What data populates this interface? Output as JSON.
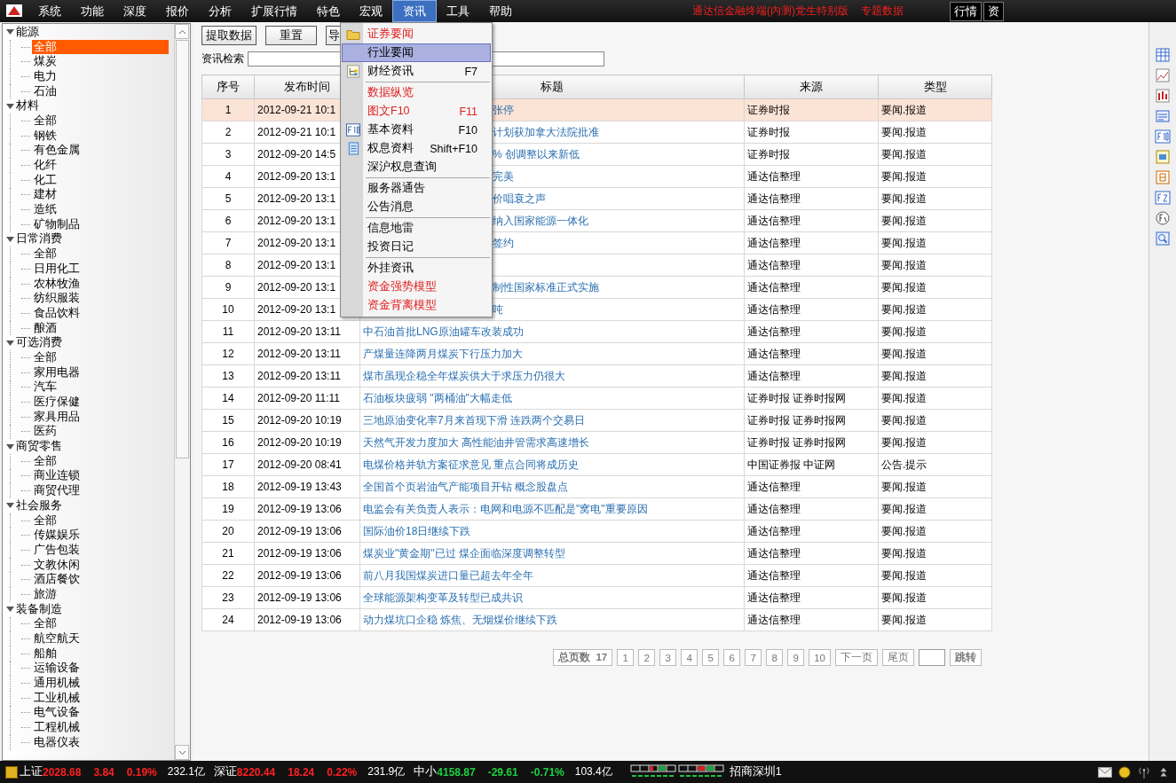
{
  "menu_bar": {
    "items": [
      {
        "label": "系统",
        "selected": false
      },
      {
        "label": "功能",
        "selected": false
      },
      {
        "label": "深度",
        "selected": false
      },
      {
        "label": "报价",
        "selected": false
      },
      {
        "label": "分析",
        "selected": false
      },
      {
        "label": "扩展行情",
        "selected": false
      },
      {
        "label": "特色",
        "selected": false
      },
      {
        "label": "宏观",
        "selected": false
      },
      {
        "label": "资讯",
        "selected": true
      },
      {
        "label": "工具",
        "selected": false
      },
      {
        "label": "帮助",
        "selected": false
      }
    ],
    "title": "通达信金融终端(内测)党生特别版",
    "subtitle": "专题数据",
    "tabs": [
      {
        "label": "行情",
        "selected": false
      },
      {
        "label": "资",
        "selected": false
      }
    ]
  },
  "sidebar": {
    "tree": [
      {
        "label": "能源",
        "expanded": true,
        "children": [
          {
            "label": "全部",
            "selected": true
          },
          {
            "label": "煤炭",
            "selected": false
          },
          {
            "label": "电力",
            "selected": false
          },
          {
            "label": "石油",
            "selected": false
          }
        ]
      },
      {
        "label": "材料",
        "expanded": true,
        "children": [
          {
            "label": "全部",
            "selected": false
          },
          {
            "label": "钢铁",
            "selected": false
          },
          {
            "label": "有色金属",
            "selected": false
          },
          {
            "label": "化纤",
            "selected": false
          },
          {
            "label": "化工",
            "selected": false
          },
          {
            "label": "建材",
            "selected": false
          },
          {
            "label": "造纸",
            "selected": false
          },
          {
            "label": "矿物制品",
            "selected": false
          }
        ]
      },
      {
        "label": "日常消费",
        "expanded": true,
        "children": [
          {
            "label": "全部",
            "selected": false
          },
          {
            "label": "日用化工",
            "selected": false
          },
          {
            "label": "农林牧渔",
            "selected": false
          },
          {
            "label": "纺织服装",
            "selected": false
          },
          {
            "label": "食品饮料",
            "selected": false
          },
          {
            "label": "酿酒",
            "selected": false
          }
        ]
      },
      {
        "label": "可选消费",
        "expanded": true,
        "children": [
          {
            "label": "全部",
            "selected": false
          },
          {
            "label": "家用电器",
            "selected": false
          },
          {
            "label": "汽车",
            "selected": false
          },
          {
            "label": "医疗保健",
            "selected": false
          },
          {
            "label": "家具用品",
            "selected": false
          },
          {
            "label": "医药",
            "selected": false
          }
        ]
      },
      {
        "label": "商贸零售",
        "expanded": true,
        "children": [
          {
            "label": "全部",
            "selected": false
          },
          {
            "label": "商业连锁",
            "selected": false
          },
          {
            "label": "商贸代理",
            "selected": false
          }
        ]
      },
      {
        "label": "社会服务",
        "expanded": true,
        "children": [
          {
            "label": "全部",
            "selected": false
          },
          {
            "label": "传媒娱乐",
            "selected": false
          },
          {
            "label": "广告包装",
            "selected": false
          },
          {
            "label": "文教休闲",
            "selected": false
          },
          {
            "label": "酒店餐饮",
            "selected": false
          },
          {
            "label": "旅游",
            "selected": false
          }
        ]
      },
      {
        "label": "装备制造",
        "expanded": true,
        "children": [
          {
            "label": "全部",
            "selected": false
          },
          {
            "label": "航空航天",
            "selected": false
          },
          {
            "label": "船舶",
            "selected": false
          },
          {
            "label": "运输设备",
            "selected": false
          },
          {
            "label": "通用机械",
            "selected": false
          },
          {
            "label": "工业机械",
            "selected": false
          },
          {
            "label": "电气设备",
            "selected": false
          },
          {
            "label": "工程机械",
            "selected": false
          },
          {
            "label": "电器仪表",
            "selected": false
          }
        ]
      }
    ]
  },
  "toolbar": {
    "buttons": [
      "提取数据",
      "重置",
      "导"
    ],
    "search_label": "资讯检索"
  },
  "table": {
    "columns": [
      "序号",
      "发布时间",
      "标题",
      "来源",
      "类型"
    ],
    "rows": [
      {
        "no": "1",
        "time": "2012-09-21 10:1",
        "title": "张停",
        "source": "证券时报",
        "type": "要闻.报道",
        "selected": true,
        "partly_covered": true
      },
      {
        "no": "2",
        "time": "2012-09-21 10:1",
        "title": "计划获加拿大法院批准",
        "source": "证券时报",
        "type": "要闻.报道",
        "selected": false,
        "partly_covered": true
      },
      {
        "no": "3",
        "time": "2012-09-20 14:5",
        "title": "% 创调整以来新低",
        "source": "证券时报",
        "type": "要闻.报道",
        "selected": false,
        "partly_covered": true
      },
      {
        "no": "4",
        "time": "2012-09-20 13:1",
        "title": "完美",
        "source": "通达信整理",
        "type": "要闻.报道",
        "selected": false,
        "partly_covered": true
      },
      {
        "no": "5",
        "time": "2012-09-20 13:1",
        "title": "价唱衰之声",
        "source": "通达信整理",
        "type": "要闻.报道",
        "selected": false,
        "partly_covered": true
      },
      {
        "no": "6",
        "time": "2012-09-20 13:1",
        "title": "纳入国家能源一体化",
        "source": "通达信整理",
        "type": "要闻.报道",
        "selected": false,
        "partly_covered": true
      },
      {
        "no": "7",
        "time": "2012-09-20 13:1",
        "title": "签约",
        "source": "通达信整理",
        "type": "要闻.报道",
        "selected": false,
        "partly_covered": true
      },
      {
        "no": "8",
        "time": "2012-09-20 13:1",
        "source": "通达信整理",
        "type": "要闻.报道",
        "selected": false
      },
      {
        "no": "9",
        "time": "2012-09-20 13:1",
        "title": "制性国家标准正式实施",
        "source": "通达信整理",
        "type": "要闻.报道",
        "selected": false,
        "partly_covered": true
      },
      {
        "no": "10",
        "time": "2012-09-20 13:1",
        "title": "吨",
        "source": "通达信整理",
        "type": "要闻.报道",
        "selected": false,
        "partly_covered": true
      },
      {
        "no": "11",
        "time": "2012-09-20 13:11",
        "title": "中石油首批LNG原油罐车改装成功",
        "source": "通达信整理",
        "type": "要闻.报道",
        "selected": false,
        "partly_covered": false
      },
      {
        "no": "12",
        "time": "2012-09-20 13:11",
        "title": "产煤量连降两月煤炭下行压力加大",
        "source": "通达信整理",
        "type": "要闻.报道",
        "selected": false,
        "partly_covered": false
      },
      {
        "no": "13",
        "time": "2012-09-20 13:11",
        "title": "煤市虽现企稳全年煤炭供大于求压力仍很大",
        "source": "通达信整理",
        "type": "要闻.报道",
        "selected": false,
        "partly_covered": false
      },
      {
        "no": "14",
        "time": "2012-09-20 11:11",
        "title": "石油板块疲弱 \"两桶油\"大幅走低",
        "source": "证券时报 证券时报网",
        "type": "要闻.报道",
        "selected": false,
        "partly_covered": false
      },
      {
        "no": "15",
        "time": "2012-09-20 10:19",
        "title": "三地原油变化率7月来首现下滑 连跌两个交易日",
        "source": "证券时报 证券时报网",
        "type": "要闻.报道",
        "selected": false,
        "partly_covered": false
      },
      {
        "no": "16",
        "time": "2012-09-20 10:19",
        "title": "天然气开发力度加大 高性能油井管需求高速增长",
        "source": "证券时报 证券时报网",
        "type": "要闻.报道",
        "selected": false,
        "partly_covered": false
      },
      {
        "no": "17",
        "time": "2012-09-20 08:41",
        "title": "电煤价格并轨方案征求意见 重点合同将成历史",
        "source": "中国证券报 中证网",
        "type": "公告.提示",
        "selected": false,
        "partly_covered": false
      },
      {
        "no": "18",
        "time": "2012-09-19 13:43",
        "title": "全国首个页岩油气产能项目开钻 概念股盘点",
        "source": "通达信整理",
        "type": "要闻.报道",
        "selected": false,
        "partly_covered": false
      },
      {
        "no": "19",
        "time": "2012-09-19 13:06",
        "title": "电监会有关负责人表示：电网和电源不匹配是\"窝电\"重要原因",
        "source": "通达信整理",
        "type": "要闻.报道",
        "selected": false,
        "partly_covered": false
      },
      {
        "no": "20",
        "time": "2012-09-19 13:06",
        "title": "国际油价18日继续下跌",
        "source": "通达信整理",
        "type": "要闻.报道",
        "selected": false,
        "partly_covered": false
      },
      {
        "no": "21",
        "time": "2012-09-19 13:06",
        "title": "煤炭业\"黄金期\"已过 煤企面临深度调整转型",
        "source": "通达信整理",
        "type": "要闻.报道",
        "selected": false,
        "partly_covered": false
      },
      {
        "no": "22",
        "time": "2012-09-19 13:06",
        "title": "前八月我国煤炭进口量已超去年全年",
        "source": "通达信整理",
        "type": "要闻.报道",
        "selected": false,
        "partly_covered": false
      },
      {
        "no": "23",
        "time": "2012-09-19 13:06",
        "title": "全球能源架构变革及转型已成共识",
        "source": "通达信整理",
        "type": "要闻.报道",
        "selected": false,
        "partly_covered": false
      },
      {
        "no": "24",
        "time": "2012-09-19 13:06",
        "title": "动力煤坑口企稳 炼焦、无烟煤价继续下跌",
        "source": "通达信整理",
        "type": "要闻.报道",
        "selected": false,
        "partly_covered": false
      }
    ]
  },
  "pagination": {
    "total_label": "总页数",
    "total": "17",
    "pages": [
      "1",
      "2",
      "3",
      "4",
      "5",
      "6",
      "7",
      "8",
      "9",
      "10"
    ],
    "next": "下一页",
    "last": "尾页",
    "jump": "跳转"
  },
  "dropdown_menu": {
    "groups": [
      [
        {
          "label": "证券要闻",
          "highlighted": true,
          "selected": false
        },
        {
          "label": "行业要闻",
          "highlighted": false,
          "selected": true
        },
        {
          "label": "财经资讯",
          "shortcut": "F7",
          "highlighted": false,
          "selected": false
        }
      ],
      [
        {
          "label": "数据纵览",
          "highlighted": true,
          "selected": false
        },
        {
          "label": "图文F10",
          "shortcut": "F11",
          "highlighted": true,
          "selected": false
        },
        {
          "label": "基本资料",
          "shortcut": "F10",
          "highlighted": false,
          "selected": false
        },
        {
          "label": "权息资料",
          "shortcut": "Shift+F10",
          "highlighted": false,
          "selected": false
        },
        {
          "label": "深沪权息查询",
          "highlighted": false,
          "selected": false
        }
      ],
      [
        {
          "label": "服务器通告",
          "highlighted": false,
          "selected": false
        },
        {
          "label": "公告消息",
          "highlighted": false,
          "selected": false
        }
      ],
      [
        {
          "label": "信息地雷",
          "highlighted": false,
          "selected": false
        },
        {
          "label": "投资日记",
          "highlighted": false,
          "selected": false
        }
      ],
      [
        {
          "label": "外挂资讯",
          "highlighted": false,
          "selected": false
        },
        {
          "label": "资金强势模型",
          "highlighted": true,
          "selected": false
        },
        {
          "label": "资金背离模型",
          "highlighted": true,
          "selected": false
        }
      ]
    ]
  },
  "status_bar": {
    "indices": [
      {
        "name": "上证",
        "value": "2028.68",
        "change": "3.84",
        "percent": "0.19%",
        "amount": "232.1亿",
        "color": "#ff2020"
      },
      {
        "name": "深证",
        "value": "8220.44",
        "change": "18.24",
        "percent": "0.22%",
        "amount": "231.9亿",
        "color": "#ff2020"
      },
      {
        "name": "中小",
        "value": "4158.87",
        "change": "-29.61",
        "percent": "-0.71%",
        "amount": "103.4亿",
        "color": "#20d040"
      }
    ],
    "server": "招商深圳1"
  }
}
